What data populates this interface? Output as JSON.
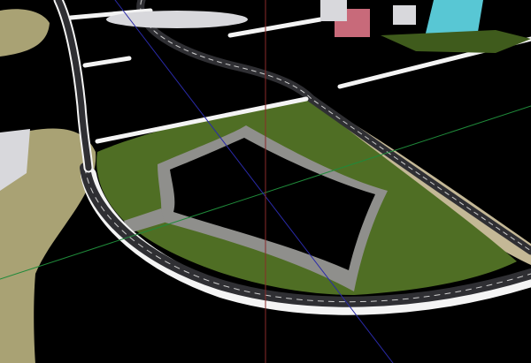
{
  "viewport": {
    "view": "perspective",
    "background_color": "#000000"
  },
  "scene": {
    "colors": {
      "grass": "#4f6e24",
      "grass_dark": "#3f5b1c",
      "sand": "#a9a274",
      "sand_light": "#c4b896",
      "path": "#8f8f8c",
      "road": "#2f2f33",
      "curb": "#f4f4f4",
      "lane_mark": "#cfcfcf",
      "axis_green": "#1f8a3a",
      "axis_blue": "#2a2aa8",
      "axis_red": "#8a2a2a",
      "building_glass": "#58c7d4",
      "building_brick": "#c86a7a",
      "building_grey": "#d8d8dc"
    },
    "objects": [
      {
        "name": "main-ring-road",
        "kind": "road"
      },
      {
        "name": "side-road-north",
        "kind": "road"
      },
      {
        "name": "park-lawn",
        "kind": "grass"
      },
      {
        "name": "park-footpath-loop",
        "kind": "path"
      },
      {
        "name": "sand-shoulder",
        "kind": "ground"
      },
      {
        "name": "distant-buildings",
        "kind": "buildings"
      }
    ]
  }
}
